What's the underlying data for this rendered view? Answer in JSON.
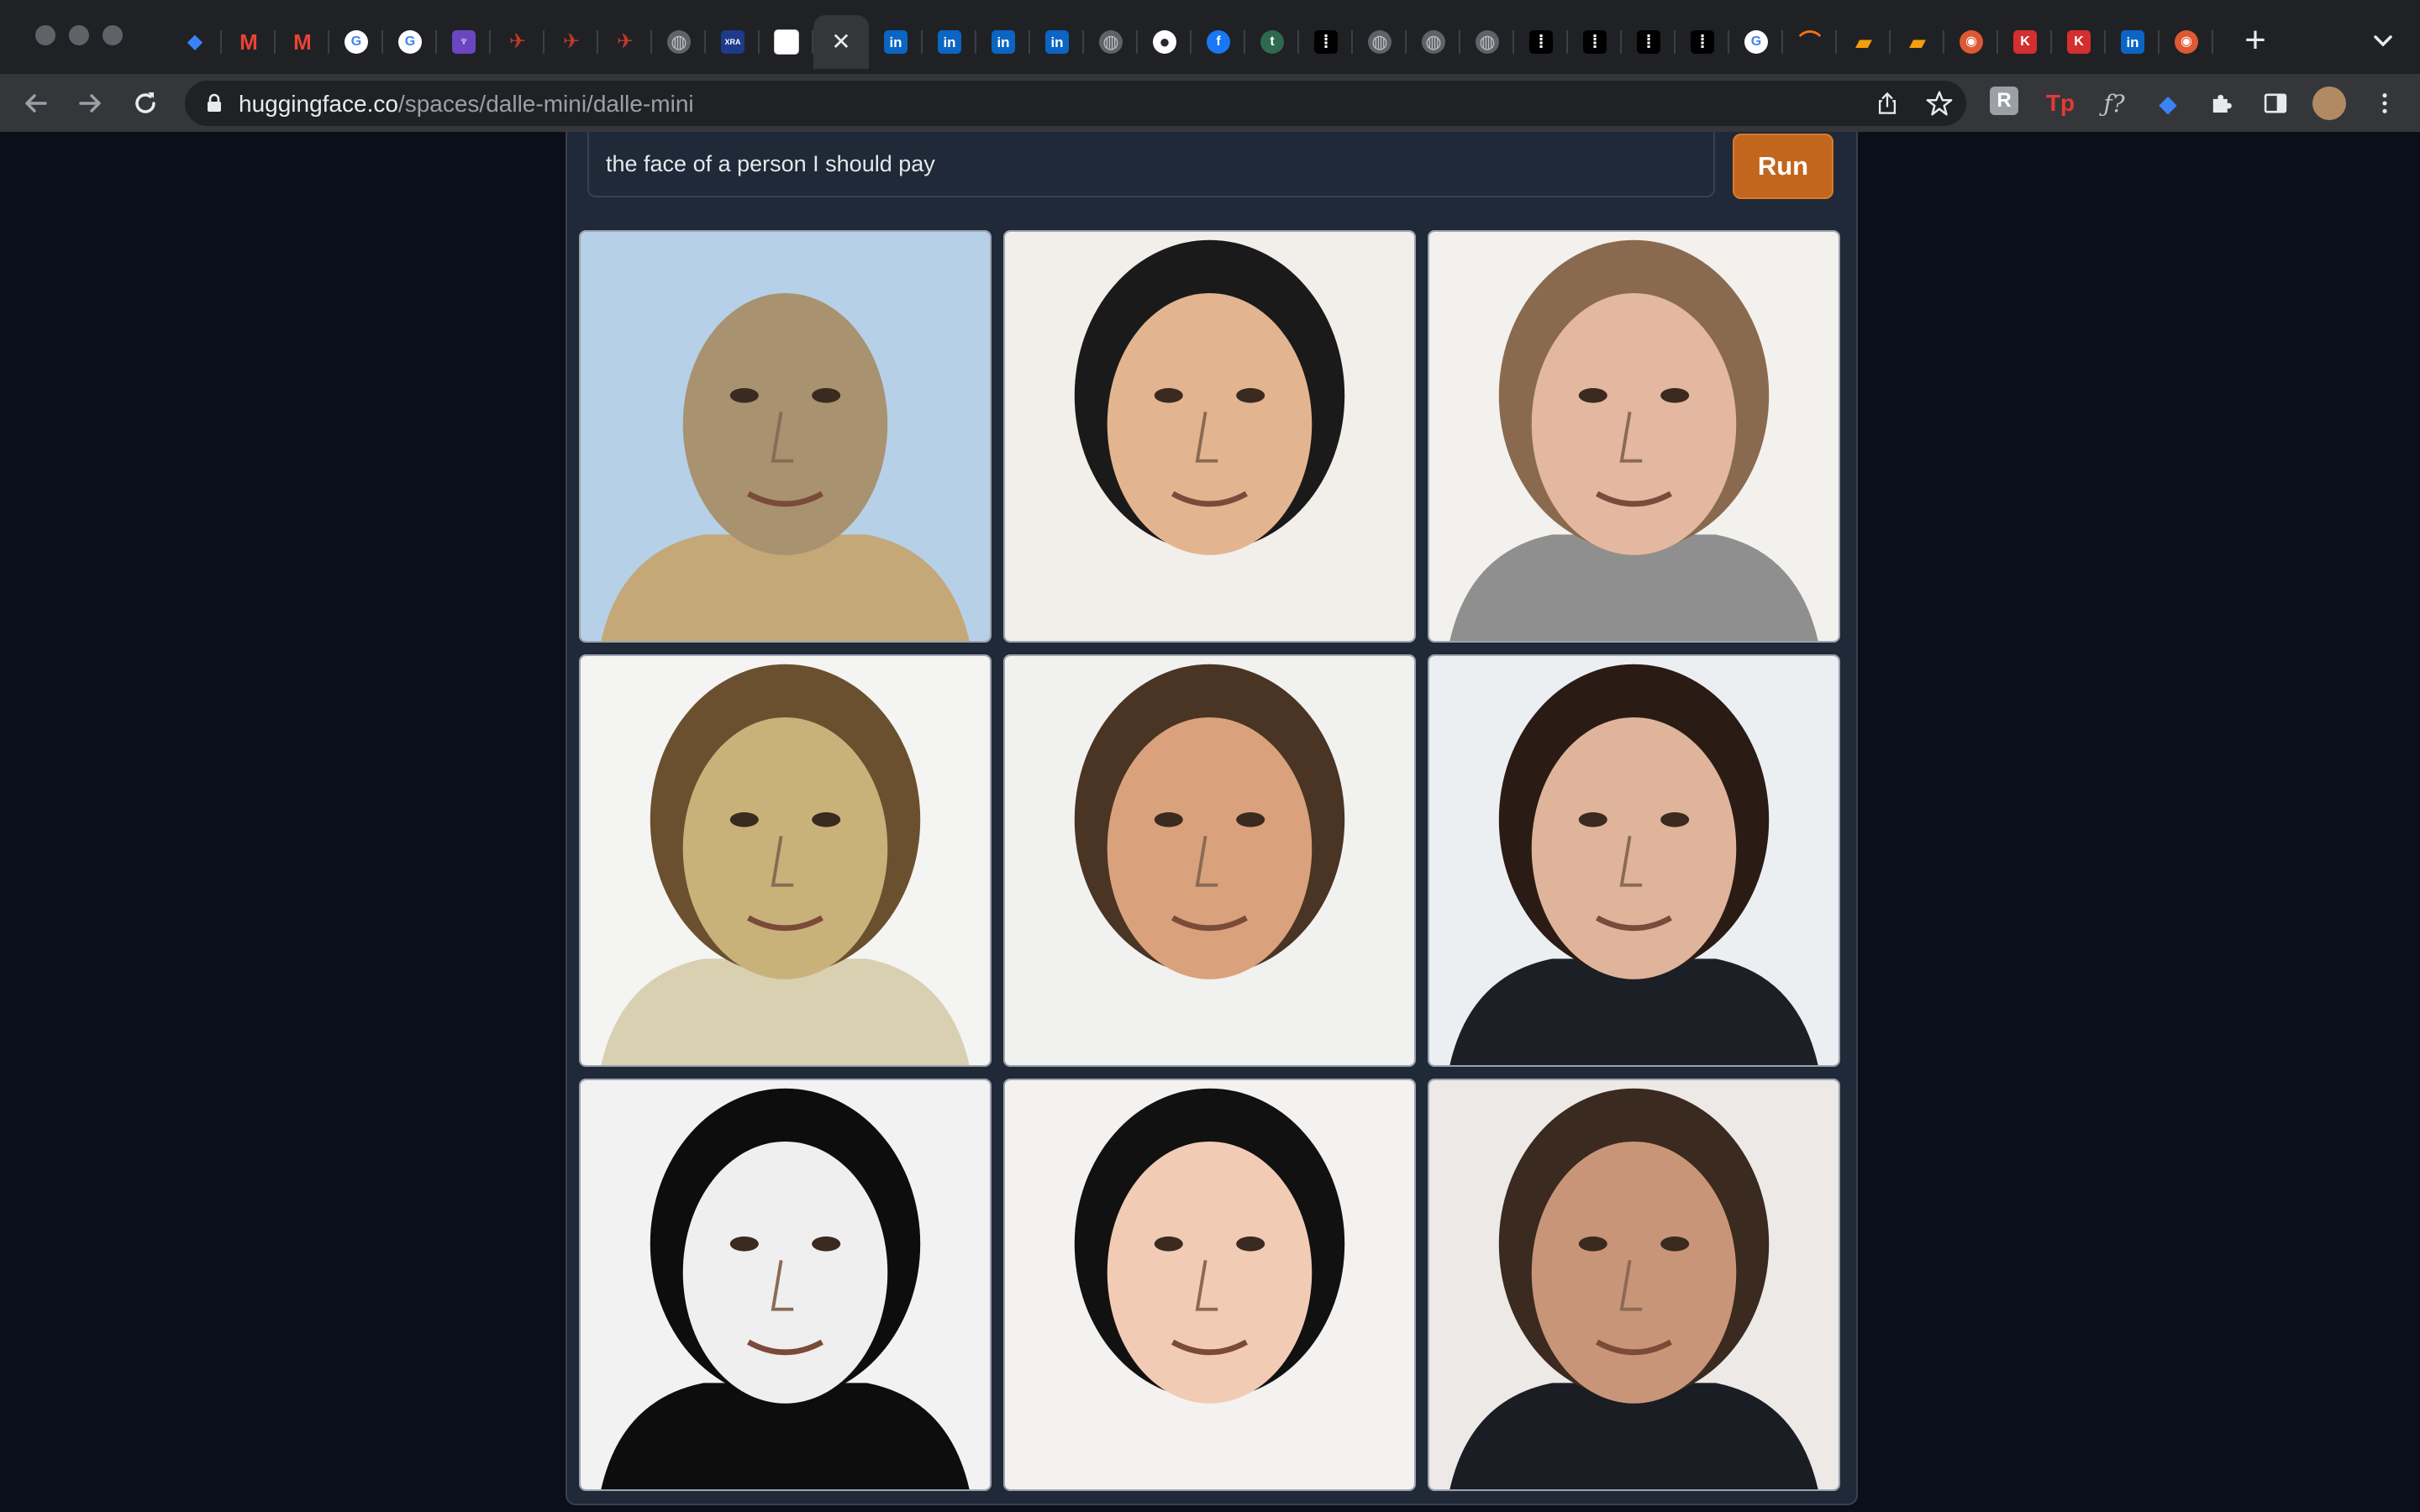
{
  "browser": {
    "tabs": [
      {
        "icon": "diamond-icon",
        "color": "#3b82f6",
        "glyph": "◆"
      },
      {
        "icon": "gmail-icon",
        "color": "#ea4335",
        "glyph": "M"
      },
      {
        "icon": "gmail-icon",
        "color": "#ea4335",
        "glyph": "M"
      },
      {
        "icon": "google-icon",
        "color": "#4285f4",
        "glyph": "G"
      },
      {
        "icon": "google-icon",
        "color": "#4285f4",
        "glyph": "G"
      },
      {
        "icon": "purple-app-icon",
        "color": "#6b46c1",
        "glyph": "♆"
      },
      {
        "icon": "red-bird-icon",
        "color": "#c0392b",
        "glyph": "✈"
      },
      {
        "icon": "red-bird-icon",
        "color": "#c0392b",
        "glyph": "✈"
      },
      {
        "icon": "red-bird-icon",
        "color": "#c0392b",
        "glyph": "✈"
      },
      {
        "icon": "globe-icon",
        "color": "#5f6368",
        "glyph": "◍"
      },
      {
        "icon": "xra-icon",
        "color": "#1e3a8a",
        "glyph": "XRA"
      },
      {
        "icon": "white-square-icon",
        "color": "#ffffff",
        "glyph": ""
      },
      {
        "icon": "close-tab-icon",
        "color": "transparent",
        "glyph": "✕",
        "active": true
      },
      {
        "icon": "linkedin-icon",
        "color": "#0a66c2",
        "glyph": "in"
      },
      {
        "icon": "linkedin-icon",
        "color": "#0a66c2",
        "glyph": "in"
      },
      {
        "icon": "linkedin-icon",
        "color": "#0a66c2",
        "glyph": "in"
      },
      {
        "icon": "linkedin-icon",
        "color": "#0a66c2",
        "glyph": "in"
      },
      {
        "icon": "globe-icon",
        "color": "#5f6368",
        "glyph": "◍"
      },
      {
        "icon": "github-icon",
        "color": "#24292f",
        "glyph": "●"
      },
      {
        "icon": "facebook-icon",
        "color": "#1877f2",
        "glyph": "f"
      },
      {
        "icon": "t-app-icon",
        "color": "#2d6a4f",
        "glyph": "t"
      },
      {
        "icon": "dots-icon",
        "color": "#000000",
        "glyph": "⁞"
      },
      {
        "icon": "globe-icon",
        "color": "#5f6368",
        "glyph": "◍"
      },
      {
        "icon": "globe-icon",
        "color": "#5f6368",
        "glyph": "◍"
      },
      {
        "icon": "globe-icon",
        "color": "#5f6368",
        "glyph": "◍"
      },
      {
        "icon": "dots-icon",
        "color": "#000000",
        "glyph": "⁞"
      },
      {
        "icon": "dots-icon",
        "color": "#000000",
        "glyph": "⁞"
      },
      {
        "icon": "dots-icon",
        "color": "#000000",
        "glyph": "⁞"
      },
      {
        "icon": "dots-icon",
        "color": "#000000",
        "glyph": "⁞"
      },
      {
        "icon": "google-icon",
        "color": "#4285f4",
        "glyph": "G"
      },
      {
        "icon": "amazon-icon",
        "color": "#202124",
        "glyph": "⌒"
      },
      {
        "icon": "book-icon",
        "color": "#f59e0b",
        "glyph": "▰"
      },
      {
        "icon": "book-icon",
        "color": "#f59e0b",
        "glyph": "▰"
      },
      {
        "icon": "duckduckgo-icon",
        "color": "#de5833",
        "glyph": "◉"
      },
      {
        "icon": "k-icon",
        "color": "#d32f2f",
        "glyph": "K"
      },
      {
        "icon": "k-icon",
        "color": "#d32f2f",
        "glyph": "K"
      },
      {
        "icon": "linkedin-icon",
        "color": "#0a66c2",
        "glyph": "in"
      },
      {
        "icon": "duckduckgo-icon",
        "color": "#de5833",
        "glyph": "◉"
      }
    ],
    "url_host": "huggingface.co",
    "url_path": "/spaces/dalle-mini/dalle-mini",
    "extensions": [
      {
        "icon": "r-extension-icon",
        "glyph": "R",
        "color": "#9aa0a6"
      },
      {
        "icon": "tp-extension-icon",
        "glyph": "Tp",
        "color": "#e53935"
      },
      {
        "icon": "formula-extension-icon",
        "glyph": "ƒ?",
        "color": "#bdc1c6"
      },
      {
        "icon": "diamond-extension-icon",
        "glyph": "◆",
        "color": "#3b82f6"
      }
    ]
  },
  "app": {
    "prompt_value": "the face of a person I should pay",
    "run_label": "Run",
    "accent": "#c2661e",
    "images": [
      {
        "name": "generated-image-1",
        "bg": "#b6d0e8",
        "skin": "#a89270",
        "hair": "none",
        "suit": "#c4a877"
      },
      {
        "name": "generated-image-2",
        "bg": "#f2efea",
        "skin": "#e2b590",
        "hair": "#1a1a1a",
        "suit": "none"
      },
      {
        "name": "generated-image-3",
        "bg": "#f3f1ee",
        "skin": "#e3b7a0",
        "hair": "#8a6a4e",
        "suit": "#8f8f8f"
      },
      {
        "name": "generated-image-4",
        "bg": "#f4f4f2",
        "skin": "#c9b27a",
        "hair": "#6b5030",
        "suit": "#d8d0b0"
      },
      {
        "name": "generated-image-5",
        "bg": "#f1f1ef",
        "skin": "#d9a27c",
        "hair": "#4a3424",
        "suit": "none"
      },
      {
        "name": "generated-image-6",
        "bg": "#eceff2",
        "skin": "#e0b49a",
        "hair": "#2a1c14",
        "suit": "#1c1f26"
      },
      {
        "name": "generated-image-7",
        "bg": "#f2f2f2",
        "skin": "#efefef",
        "hair": "#0d0d0d",
        "suit": "#0d0d0d"
      },
      {
        "name": "generated-image-8",
        "bg": "#f4f2f0",
        "skin": "#f2cbb4",
        "hair": "#111111",
        "suit": "none"
      },
      {
        "name": "generated-image-9",
        "bg": "#ece9e6",
        "skin": "#c99578",
        "hair": "#3a2a20",
        "suit": "#1a1d24"
      }
    ]
  }
}
